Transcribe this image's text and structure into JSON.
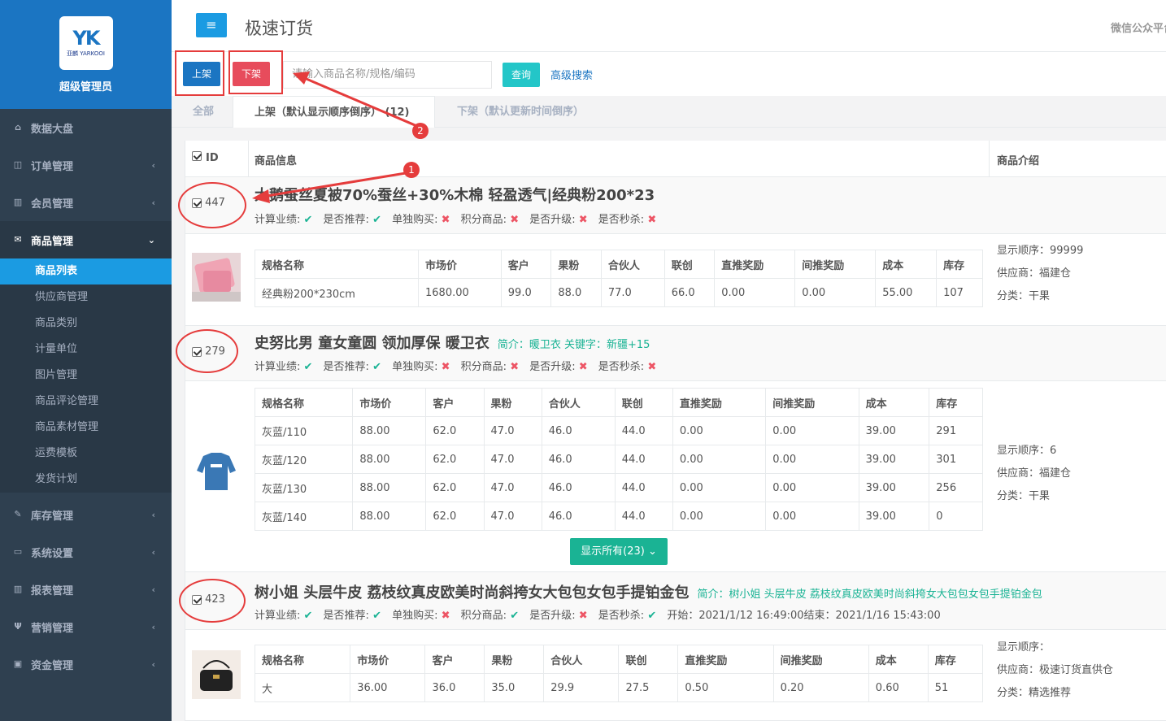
{
  "sidebar": {
    "logo_mark": "YK",
    "logo_sub": "亚麟 YARKOOI",
    "role": "超级管理员",
    "items": [
      {
        "label": "数据大盘",
        "icon": "home-icon",
        "arrow": ""
      },
      {
        "label": "订单管理",
        "icon": "columns-icon",
        "arrow": "‹"
      },
      {
        "label": "会员管理",
        "icon": "bar-chart-icon",
        "arrow": "‹"
      },
      {
        "label": "商品管理",
        "icon": "envelope-icon",
        "arrow": "⌄"
      },
      {
        "label": "库存管理",
        "icon": "edit-icon",
        "arrow": "‹"
      },
      {
        "label": "系统设置",
        "icon": "desktop-icon",
        "arrow": "‹"
      },
      {
        "label": "报表管理",
        "icon": "bar-chart-icon",
        "arrow": "‹"
      },
      {
        "label": "营销管理",
        "icon": "cutlery-icon",
        "arrow": "‹"
      },
      {
        "label": "资金管理",
        "icon": "money-icon",
        "arrow": "‹"
      }
    ],
    "sub_items": [
      "商品列表",
      "供应商管理",
      "商品类别",
      "计量单位",
      "图片管理",
      "商品评论管理",
      "商品素材管理",
      "运费模板",
      "发货计划"
    ]
  },
  "header": {
    "menu_icon": "≡",
    "title": "极速订货",
    "wechat": "微信公众平台"
  },
  "toolbar": {
    "up_label": "上架",
    "down_label": "下架",
    "search_placeholder": "请输入商品名称/规格/编码",
    "query_label": "查询",
    "advanced_label": "高级搜索"
  },
  "tabs": [
    "全部",
    "上架（默认显示顺序倒序）  (12)",
    "下架（默认更新时间倒序）"
  ],
  "table": {
    "col_id": "ID",
    "col_info": "商品信息",
    "col_intro": "商品介绍"
  },
  "spec_headers": [
    "规格名称",
    "市场价",
    "客户",
    "果粉",
    "合伙人",
    "联创",
    "直推奖励",
    "间推奖励",
    "成本",
    "库存"
  ],
  "products": [
    {
      "id": "447",
      "name": "大鹅蚕丝夏被70%蚕丝+30%木棉 轻盈透气|经典粉200*23",
      "intro": "",
      "meta": "计算业绩: ✔   是否推荐: ✔   单独购买: ✖   积分商品: ✖   是否升级: ✖   是否秒杀: ✖",
      "rows": [
        [
          "经典粉200*230cm",
          "1680.00",
          "99.0",
          "88.0",
          "77.0",
          "66.0",
          "0.00",
          "0.00",
          "55.00",
          "107"
        ]
      ],
      "side": {
        "order": "显示顺序：99999",
        "supplier": "供应商：福建仓",
        "category": "分类：干果"
      }
    },
    {
      "id": "279",
      "name": "史努比男 童女童圆 领加厚保 暖卫衣",
      "intro": "简介：暖卫衣   关键字：新疆+15",
      "meta": "计算业绩: ✔   是否推荐: ✔   单独购买: ✖   积分商品: ✖   是否升级: ✖   是否秒杀: ✖",
      "rows": [
        [
          "灰蓝/110",
          "88.00",
          "62.0",
          "47.0",
          "46.0",
          "44.0",
          "0.00",
          "0.00",
          "39.00",
          "291"
        ],
        [
          "灰蓝/120",
          "88.00",
          "62.0",
          "47.0",
          "46.0",
          "44.0",
          "0.00",
          "0.00",
          "39.00",
          "301"
        ],
        [
          "灰蓝/130",
          "88.00",
          "62.0",
          "47.0",
          "46.0",
          "44.0",
          "0.00",
          "0.00",
          "39.00",
          "256"
        ],
        [
          "灰蓝/140",
          "88.00",
          "62.0",
          "47.0",
          "46.0",
          "44.0",
          "0.00",
          "0.00",
          "39.00",
          "0"
        ]
      ],
      "show_all": "显示所有(23) ⌄",
      "side": {
        "order": "显示顺序：6",
        "supplier": "供应商：福建仓",
        "category": "分类：干果"
      }
    },
    {
      "id": "423",
      "name": "树小姐 头层牛皮 荔枝纹真皮欧美时尚斜挎女大包包女包手提铂金包",
      "intro": "简介：树小姐 头层牛皮 荔枝纹真皮欧美时尚斜挎女大包包女包手提铂金包",
      "meta": "计算业绩: ✔   是否推荐: ✔   单独购买: ✖   积分商品: ✔   是否升级: ✖   是否秒杀: ✔   开始：2021/1/12 16:49:00结束：2021/1/16 15:43:00",
      "rows": [
        [
          "大",
          "36.00",
          "36.0",
          "35.0",
          "29.9",
          "27.5",
          "0.50",
          "0.20",
          "0.60",
          "51"
        ]
      ],
      "side": {
        "order": "显示顺序：",
        "supplier": "供应商：极速订货直供仓",
        "category": "分类：精选推荐"
      }
    }
  ],
  "annotations": {
    "badge1": "1",
    "badge2": "2"
  },
  "colors": {
    "primary": "#1b75c2",
    "danger": "#e74c5c",
    "teal": "#23c6c8",
    "green": "#1ab394",
    "sidebar": "#2f4050",
    "annotation": "#e53c3c"
  }
}
